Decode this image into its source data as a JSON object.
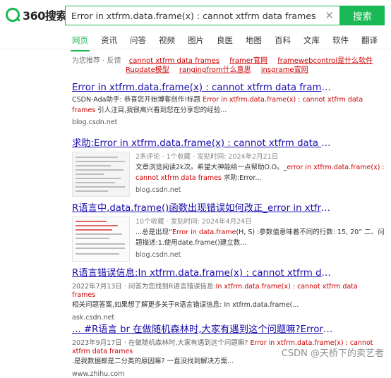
{
  "logo": {
    "text": "360搜索"
  },
  "search": {
    "value": "Error in xtfrm.data.frame(x) : cannot xtfrm data frames",
    "button": "搜索"
  },
  "tabs": [
    "网页",
    "资讯",
    "问答",
    "视频",
    "图片",
    "良医",
    "地图",
    "百科",
    "文库",
    "软件",
    "翻译"
  ],
  "suggest": {
    "label": "为您推荐 · 反馈",
    "links": [
      "cannot xtfrm data frames",
      "framer官网",
      "framewebcontrol是什么软件",
      "Rupdate模型",
      "rangingfrom什么意思",
      "insgrame官网"
    ]
  },
  "results": [
    {
      "title": "Error in xtfrm.data.frame(x) : cannot xtfrm data frames-CSDN博客",
      "desc_a": "CSDN-Ada助手: 恭喜您开始博客创作!标题 ",
      "desc_b": "Error in xtfrm.data.frame(x) : cannot xtfrm data frames",
      "desc_c": " 引人注目,我很高兴看到您在分享您的经验...",
      "url": "blog.csdn.net"
    },
    {
      "title": "求助:Error in xtfrm.data.frame(x) : cannot xtfrm data frames-CSDN",
      "meta": "2条评论 · 1个收藏 · 发贴时间: 2024年2月21日",
      "desc_a": "文章浏览阅读2k次。希望大神能给一点帮助O.O。_",
      "desc_b": "error in xtfrm.data.frame(x) : cannot xtfrm data frames",
      "desc_c": " 求助:Error...",
      "url": "blog.csdn.net"
    },
    {
      "title": "R语言中,data.frame()函数出现错误如何改正_error in xtfrm.data.fr...",
      "meta": "10个收藏 · 发贴时间: 2024年4月24日",
      "desc_a": "...总是出现“",
      "desc_b": "Error in data.frame",
      "desc_c": "(H, S) :参数值意味着不同的行数: 15, 20” 二、问题描述:1.使用date.frame()建立数...",
      "url": "blog.csdn.net"
    },
    {
      "title": "R语言错误信息:In xtfrm.data.frame(x) : cannot xtfrm data frames",
      "meta": "2022年7月13日 · 问答为您找到R语言错误信息:",
      "meta_b": "In xtfrm.data.frame(x) : cannot xtfrm data frames",
      "desc_c": "相关问题答案,如果想了解更多关于R语言错误信息: In xtfrm.data.frame(...",
      "url": "ask.csdn.net"
    },
    {
      "title": "... #R语言 br 在做随机森林时,大家有遇到这个问题嘛?Error in xtfrm...",
      "meta": "2023年9月17日 · 在做随机森林时,大家有遇到这个问题嘛? ",
      "meta_b": "Error in xtfrm.data.frame(x) : cannot xtfrm data frames",
      "desc_c": ".是我数据都是二分类的原因嘛? 一直没找到解决方案...",
      "url": "www.zhihu.com"
    }
  ],
  "watermark": "CSDN @天桥下的卖艺者"
}
